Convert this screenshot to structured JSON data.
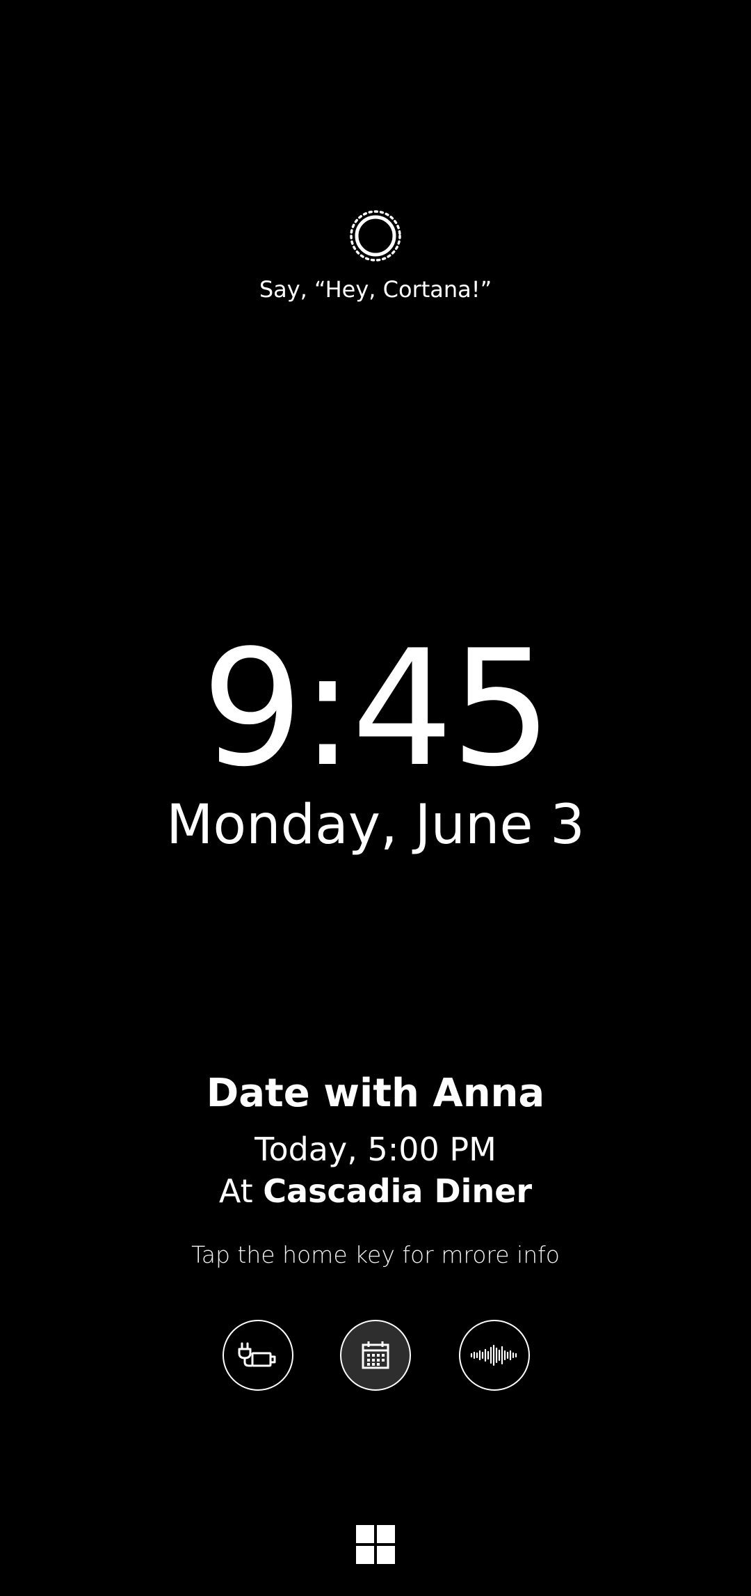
{
  "cortana": {
    "icon": "cortana-ring-icon",
    "prompt": "Say, “Hey, Cortana!”"
  },
  "clock": {
    "time": "9:45",
    "date": "Monday, June 3"
  },
  "event": {
    "title": "Date with Anna",
    "time": "Today, 5:00 PM",
    "place_prefix": "At",
    "place_name": "Cascadia Diner"
  },
  "hint": "Tap the home key for mrore info",
  "actions": [
    {
      "icon": "charging-plug-battery-icon"
    },
    {
      "icon": "calendar-icon",
      "selected": true
    },
    {
      "icon": "voice-waveform-icon"
    }
  ],
  "home": {
    "icon": "windows-logo-icon"
  },
  "colors": {
    "background": "#000000",
    "foreground": "#ffffff",
    "selected_button": "#2e2e2e"
  }
}
